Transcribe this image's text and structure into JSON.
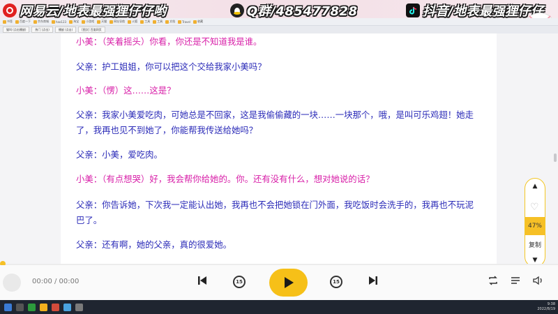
{
  "overlay": {
    "left_text": "网易云/地表最强狸仔仔哟",
    "middle_text": "Q群/485477828",
    "right_text": "抖音/地表最强狸仔仔"
  },
  "bookmarks": [
    "书签",
    "百度一下",
    "京东商城",
    "hao123",
    "淘宝",
    "小游戏",
    "天猫",
    "网址导航",
    "火狐",
    "工具",
    "工具",
    "文档",
    "Travel",
    "收藏"
  ],
  "tabs": [
    "猫叫 (点击播放)",
    "热门 (点击)",
    "播放 (点击)",
    "[图文] 百度网页"
  ],
  "dialogue": [
    {
      "text": "小美：（笑着摇头）你看，你还是不知道我是谁。",
      "speaker": "xiaomei"
    },
    {
      "text": "父亲：护工姐姐，你可以把这个交给我家小美吗？",
      "speaker": "father"
    },
    {
      "text": "小美：（愣）这……这是？",
      "speaker": "xiaomei"
    },
    {
      "text": "父亲：我家小美爱吃肉，可她总是不回家，这是我偷偷藏的一块……一块那个，哦，是叫可乐鸡翅！她走了，我再也见不到她了，你能帮我传送给她吗？",
      "speaker": "father"
    },
    {
      "text": "父亲：小美，爱吃肉。",
      "speaker": "father"
    },
    {
      "text": "小美：（有点想哭）好，我会帮你给她的。你。还有没有什么，想对她说的话？",
      "speaker": "xiaomei"
    },
    {
      "text": "父亲：你告诉她，下次我一定能认出她，我再也不会把她锁在门外面，我吃饭时会洗手的，我再也不玩泥巴了。",
      "speaker": "father"
    },
    {
      "text": "父亲：还有啊，她的父亲，真的很爱她。",
      "speaker": "father"
    }
  ],
  "side_panel": {
    "up_arrow": "▲",
    "favorite_icon": "heart-icon",
    "percent": "47%",
    "copy_label": "复制",
    "down_arrow": "▼"
  },
  "player": {
    "time": "00:00 / 00:00",
    "rewind_label": "15",
    "forward_label": "15",
    "play_icon": "play-icon"
  },
  "taskbar": {
    "tray_line1": "9:38",
    "tray_line2": "2022/8/19"
  },
  "colors": {
    "accent": "#f6c018",
    "father": "#2b2bb8",
    "xiaomei": "#d81fa8"
  }
}
